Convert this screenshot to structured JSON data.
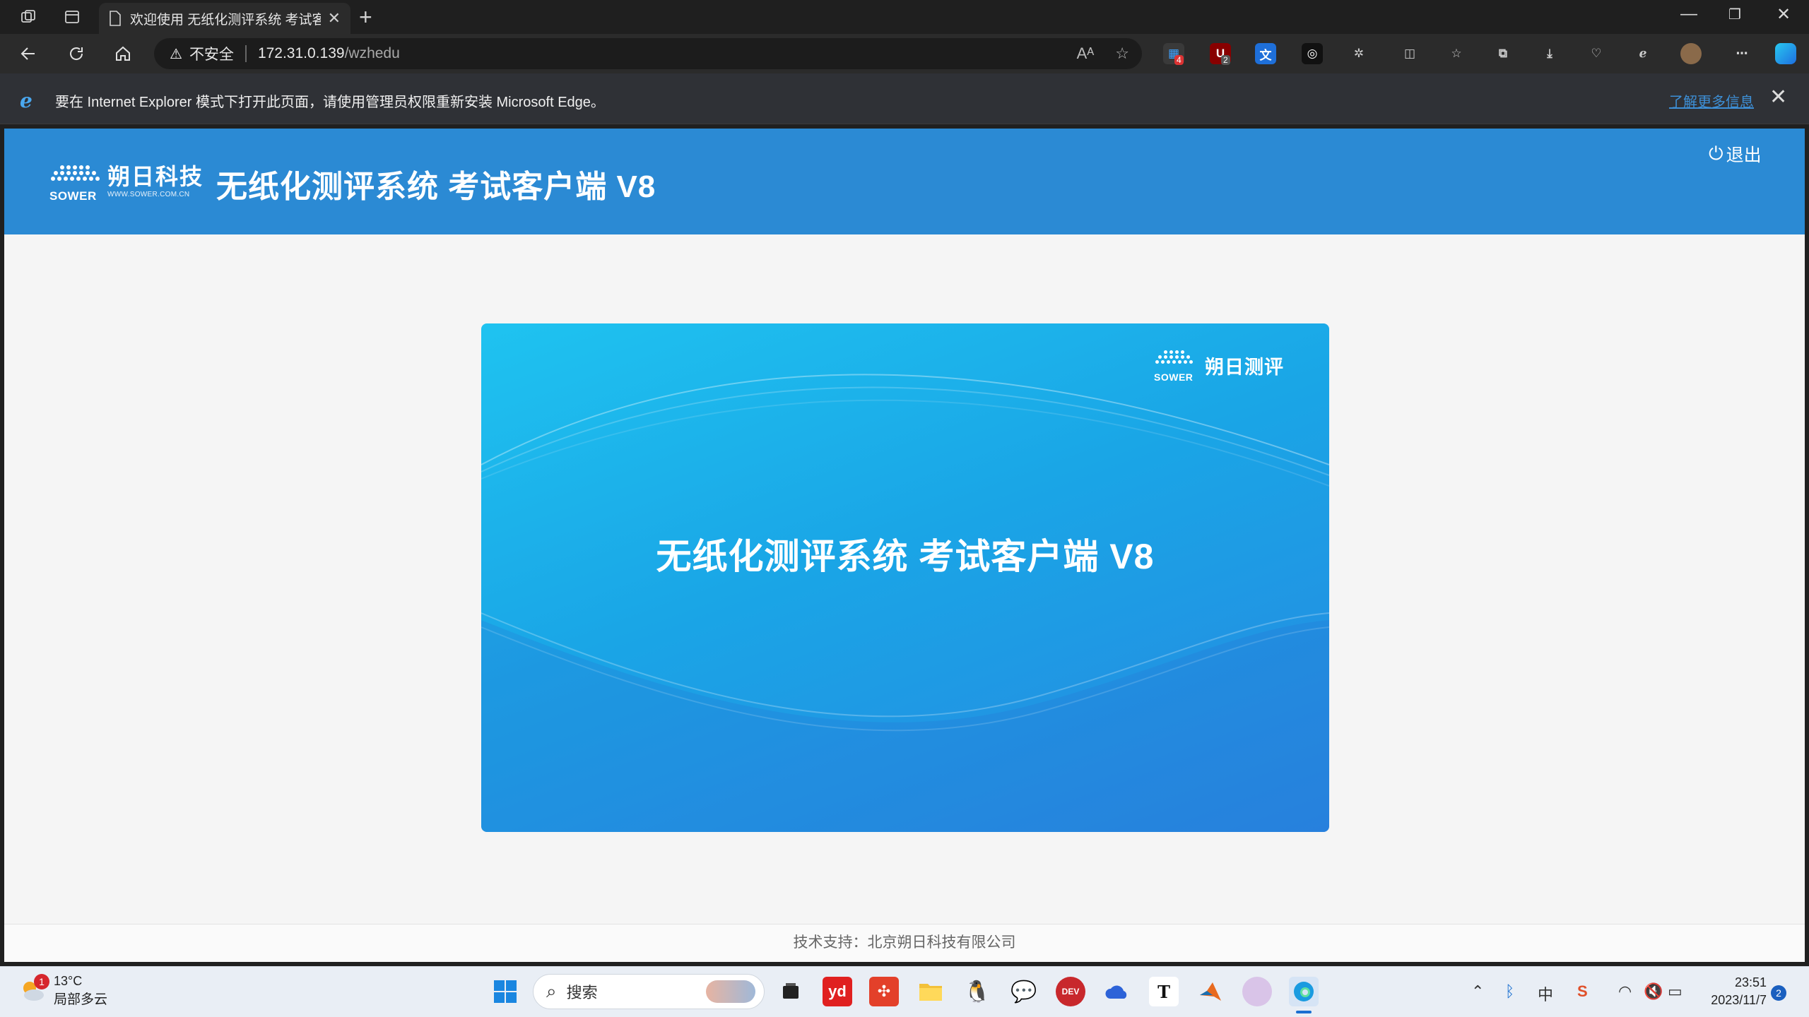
{
  "browser": {
    "tab_title": "欢迎使用 无纸化测评系统 考试客",
    "address": {
      "insecure_label": "不安全",
      "host": "172.31.0.139",
      "path": "/wzhedu"
    },
    "infobar": {
      "message": "要在 Internet Explorer 模式下打开此页面，请使用管理员权限重新安装 Microsoft Edge。",
      "link": "了解更多信息"
    },
    "extension_badges": {
      "first": "4",
      "second": "2"
    }
  },
  "app": {
    "brand_cn": "朔日科技",
    "brand_en": "SOWER",
    "brand_url": "WWW.SOWER.COM.CN",
    "title": "无纸化测评系统 考试客户端 V8",
    "logout_label": "退出",
    "banner": {
      "brand_en": "SOWER",
      "brand_name": "朔日测评",
      "title": "无纸化测评系统 考试客户端 V8"
    },
    "footer": "技术支持：北京朔日科技有限公司"
  },
  "taskbar": {
    "weather": {
      "badge": "1",
      "temp": "13°C",
      "condition": "局部多云"
    },
    "search_placeholder": "搜索",
    "tray": {
      "ime": "中"
    },
    "clock": {
      "time": "23:51",
      "date": "2023/11/7"
    },
    "notification_count": "2"
  },
  "colors": {
    "header_blue": "#2b8ad4",
    "banner_light": "#1fc3f0",
    "banner_dark": "#2786e0"
  }
}
